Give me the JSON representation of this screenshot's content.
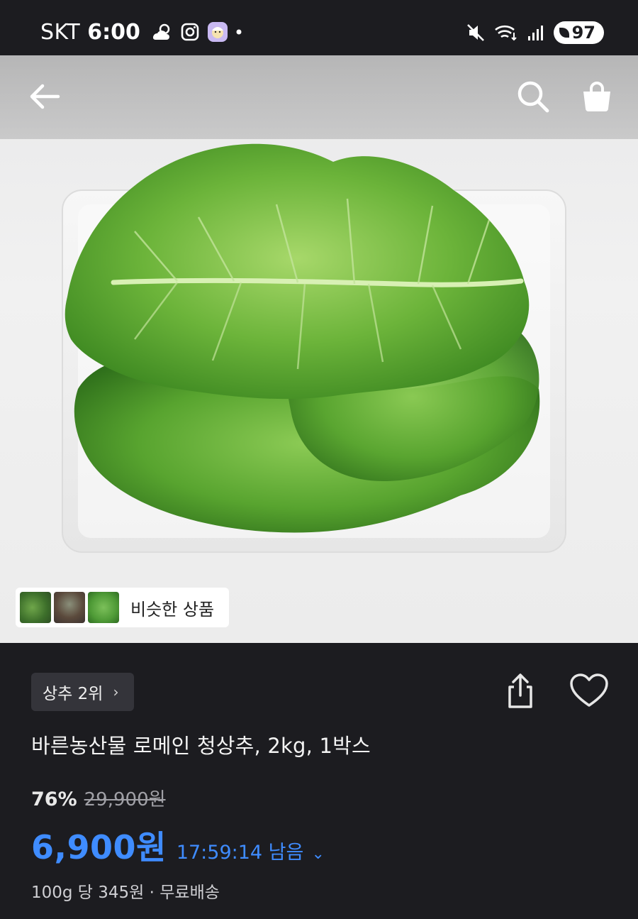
{
  "status_bar": {
    "carrier": "SKT",
    "time": "6:00",
    "battery": "97"
  },
  "hero": {
    "similar_label": "비슷한 상품"
  },
  "product": {
    "rank_label": "상추 2위",
    "title": "바른농산물 로메인 청상추, 2kg, 1박스",
    "discount": "76%",
    "original_price": "29,900원",
    "price": "6,900원",
    "countdown": "17:59:14 남음",
    "unit_info": "100g 당 345원 · 무료배송"
  },
  "colors": {
    "accent": "#3f8cff",
    "background": "#1c1c20"
  },
  "icons": [
    "back-arrow-icon",
    "search-icon",
    "cart-icon",
    "share-icon",
    "heart-icon",
    "chevron-right-icon",
    "chevron-down-icon"
  ]
}
